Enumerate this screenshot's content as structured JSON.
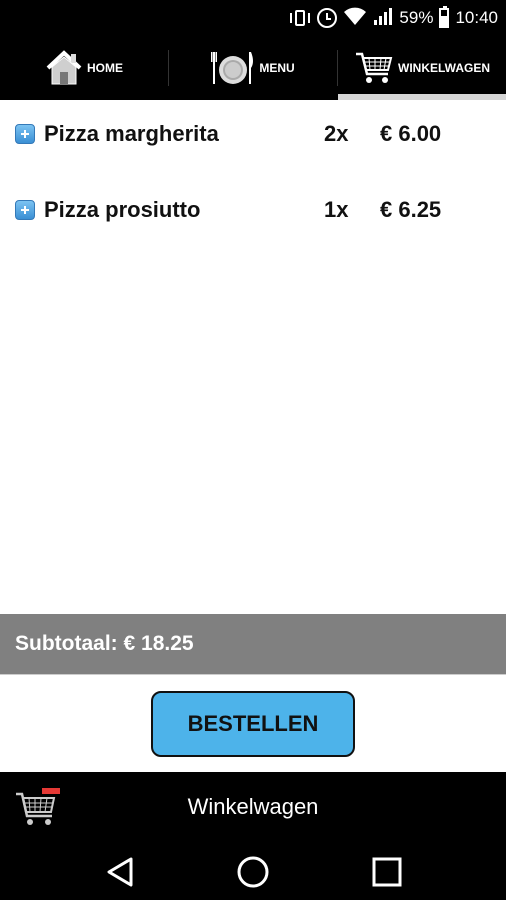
{
  "status_bar": {
    "battery": "59%",
    "time": "10:40",
    "icons": [
      "vibrate-icon",
      "alarm-icon",
      "wifi-icon",
      "signal-icon",
      "battery-icon"
    ]
  },
  "nav": {
    "tabs": [
      {
        "label": "HOME",
        "icon": "home-icon",
        "active": false
      },
      {
        "label": "MENU",
        "icon": "plate-cutlery-icon",
        "active": false
      },
      {
        "label": "WINKELWAGEN",
        "icon": "shopping-cart-icon",
        "active": true
      }
    ]
  },
  "cart": {
    "items": [
      {
        "icon": "plus-icon",
        "name": "Pizza margherita",
        "quantity": "2x",
        "price": "€ 6.00"
      },
      {
        "icon": "plus-icon",
        "name": "Pizza prosiutto",
        "quantity": "1x",
        "price": "€ 6.25"
      }
    ]
  },
  "subtotal": {
    "text": "Subtotaal: € 18.25"
  },
  "order": {
    "button_label": "BESTELLEN",
    "button_color": "#4db3ea"
  },
  "bottom_bar": {
    "title": "Winkelwagen",
    "icon": "cart-badge-icon"
  },
  "system_nav": {
    "buttons": [
      "back-icon",
      "home-circle-icon",
      "recents-icon"
    ]
  }
}
